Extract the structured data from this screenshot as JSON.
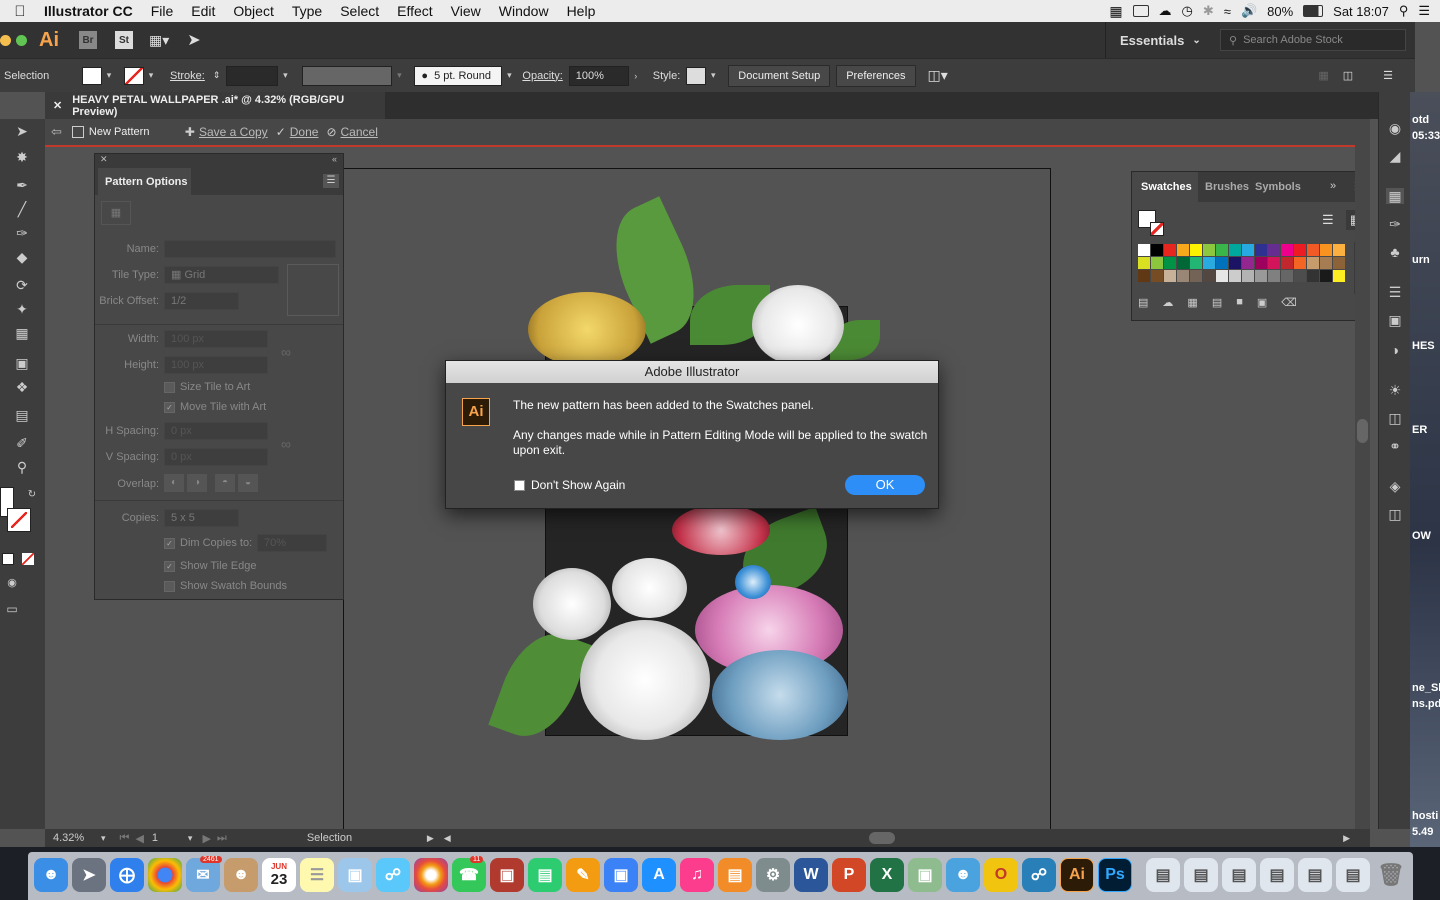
{
  "menubar": {
    "app_name": "Illustrator CC",
    "items": [
      "File",
      "Edit",
      "Object",
      "Type",
      "Select",
      "Effect",
      "View",
      "Window",
      "Help"
    ],
    "battery": "80%",
    "clock": "Sat 18:07"
  },
  "appbar": {
    "logo": "Ai",
    "bridge": "Br",
    "stock_short": "St",
    "workspace": "Essentials",
    "search_placeholder": "Search Adobe Stock"
  },
  "controlbar": {
    "selection_label": "Selection",
    "stroke_label": "Stroke:",
    "brush_label": "5 pt. Round",
    "opacity_label": "Opacity:",
    "opacity_value": "100%",
    "style_label": "Style:",
    "document_setup": "Document Setup",
    "preferences": "Preferences"
  },
  "document": {
    "tab_title": "HEAVY PETAL WALLPAPER .ai* @ 4.32% (RGB/GPU Preview)"
  },
  "pattern_bar": {
    "label": "New Pattern",
    "save_copy": "Save a Copy",
    "done": "Done",
    "cancel": "Cancel"
  },
  "pattern_options": {
    "title": "Pattern Options",
    "name_label": "Name:",
    "tile_type_label": "Tile Type:",
    "tile_type_value": "Grid",
    "brick_offset_label": "Brick Offset:",
    "brick_offset_value": "1/2",
    "width_label": "Width:",
    "width_value": "100 px",
    "height_label": "Height:",
    "height_value": "100 px",
    "size_tile_to_art": "Size Tile to Art",
    "move_tile_with_art": "Move Tile with Art",
    "h_spacing_label": "H Spacing:",
    "h_spacing_value": "0 px",
    "v_spacing_label": "V Spacing:",
    "v_spacing_value": "0 px",
    "overlap_label": "Overlap:",
    "copies_label": "Copies:",
    "copies_value": "5 x 5",
    "dim_copies": "Dim Copies to:",
    "dim_copies_value": "70%",
    "show_tile_edge": "Show Tile Edge",
    "show_swatch_bounds": "Show Swatch Bounds"
  },
  "swatches_panel": {
    "tabs": [
      "Swatches",
      "Brushes",
      "Symbols"
    ],
    "colors": [
      "#ffffff",
      "#000000",
      "#e6261f",
      "#f7a81b",
      "#fff200",
      "#8dc63f",
      "#39b54a",
      "#00a79d",
      "#27aae1",
      "#2e3192",
      "#662d91",
      "#ec008c",
      "#ed1c24",
      "#f15a24",
      "#f7931e",
      "#fbb040",
      "#d9e021",
      "#8cc63f",
      "#009245",
      "#006837",
      "#22b573",
      "#29abe2",
      "#0071bc",
      "#1b1464",
      "#93278f",
      "#9e005d",
      "#d4145a",
      "#c1272d",
      "#f26522",
      "#c69c6d",
      "#a67c52",
      "#8c6239",
      "#603813",
      "#754c24",
      "#c7b299",
      "#998675",
      "#736357",
      "#534741",
      "#e6e6e6",
      "#cccccc",
      "#b3b3b3",
      "#999999",
      "#808080",
      "#666666",
      "#4d4d4d",
      "#333333",
      "#1a1a1a",
      "#fcee21"
    ]
  },
  "dialog": {
    "title": "Adobe Illustrator",
    "icon": "Ai",
    "message": "The new pattern has been added to the Swatches panel.",
    "detail": "Any changes made while in Pattern Editing Mode will be applied to the swatch upon exit.",
    "dont_show": "Don't Show Again",
    "ok": "OK"
  },
  "statusbar": {
    "zoom": "4.32%",
    "artboard": "1",
    "tool": "Selection"
  },
  "desktop": {
    "labels": [
      "otd",
      "05:33",
      "urn",
      "HES",
      "ER",
      "OW",
      "ne_Sl",
      "ns.pd",
      "hosti",
      "5.49"
    ]
  },
  "dock": {
    "mail_badge": "2461",
    "calendar_month": "JUN",
    "calendar_day": "23",
    "messages_badge": "11"
  }
}
